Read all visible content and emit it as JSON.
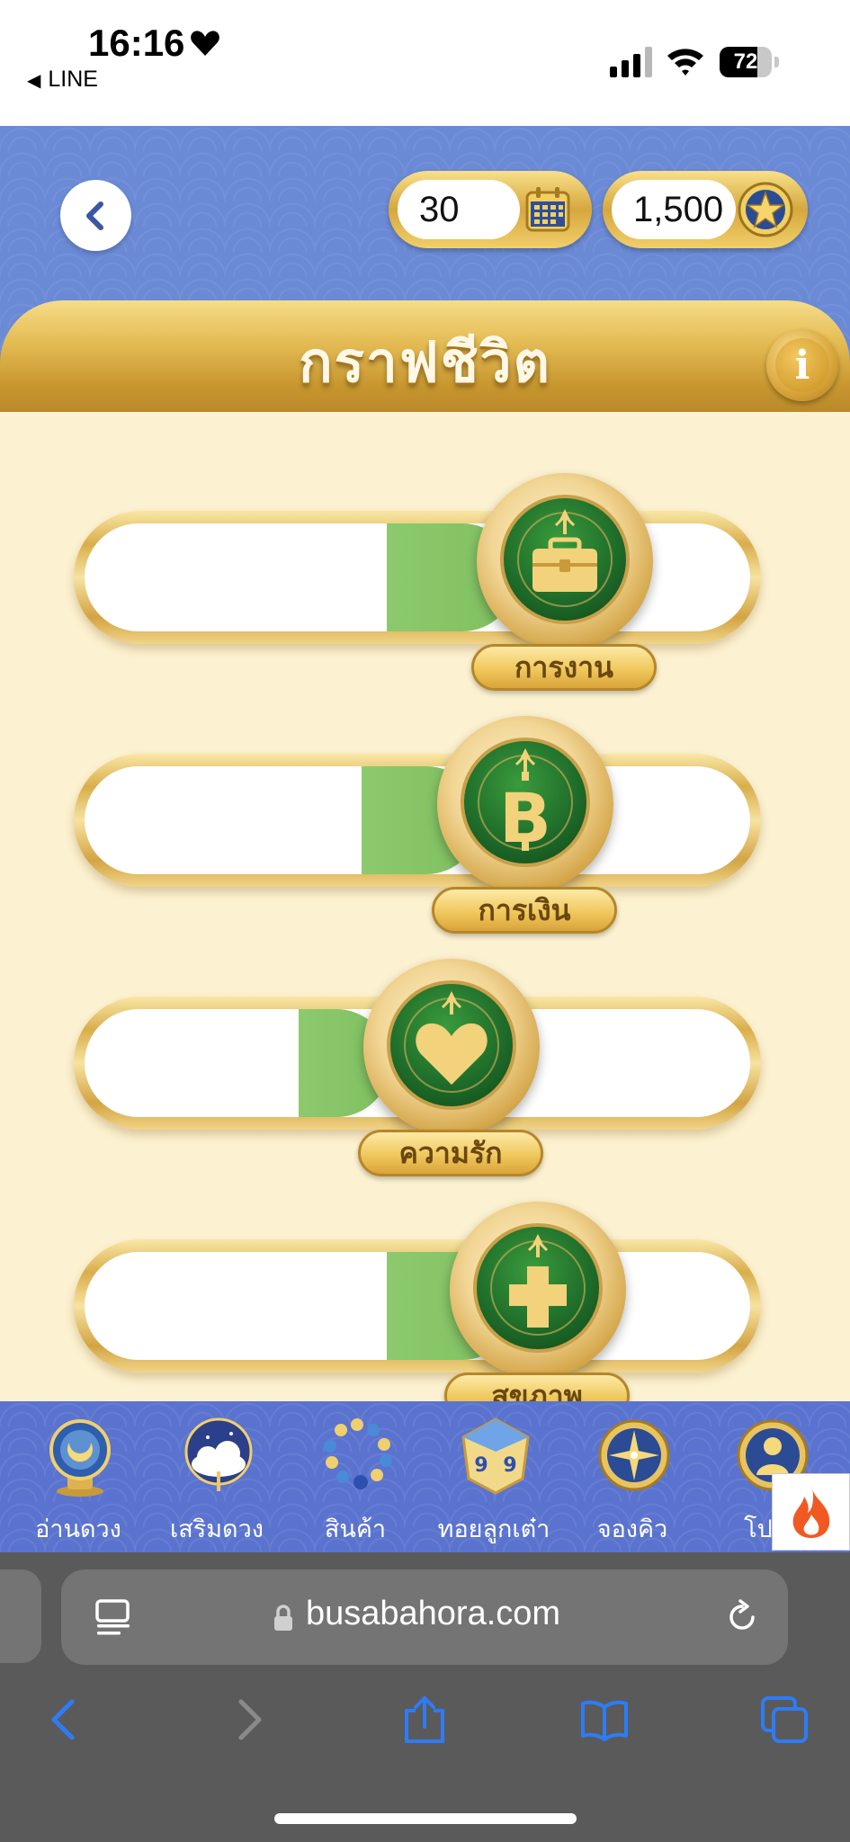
{
  "status_bar": {
    "time": "16:16",
    "back_app": "LINE",
    "battery": "72",
    "battery_level": 0.72
  },
  "header": {
    "days_value": "30",
    "coins_value": "1,500",
    "title": "กราฟชีวิต"
  },
  "graphs": [
    {
      "label": "การงาน",
      "icon": "briefcase-icon"
    },
    {
      "label": "การเงิน",
      "icon": "baht-icon"
    },
    {
      "label": "ความรัก",
      "icon": "heart-icon"
    },
    {
      "label": "สุขภาพ",
      "icon": "health-cross-icon"
    }
  ],
  "tabbar": {
    "items": [
      {
        "label": "อ่านดวง",
        "icon": "crystal-ball-icon"
      },
      {
        "label": "เสริมดวง",
        "icon": "cloud-icon"
      },
      {
        "label": "สินค้า",
        "icon": "bracelet-icon"
      },
      {
        "label": "ทอยลูกเต๋า",
        "icon": "dice-icon"
      },
      {
        "label": "จองคิว",
        "icon": "compass-icon"
      },
      {
        "label": "โปรไ",
        "icon": "profile-icon"
      }
    ]
  },
  "browser": {
    "url": "busabahora.com"
  },
  "colors": {
    "header_blue": "#6b8ad6",
    "gold": "#d6a73e",
    "cream": "#fcf1d0",
    "medal_green": "#1f6d2a"
  }
}
